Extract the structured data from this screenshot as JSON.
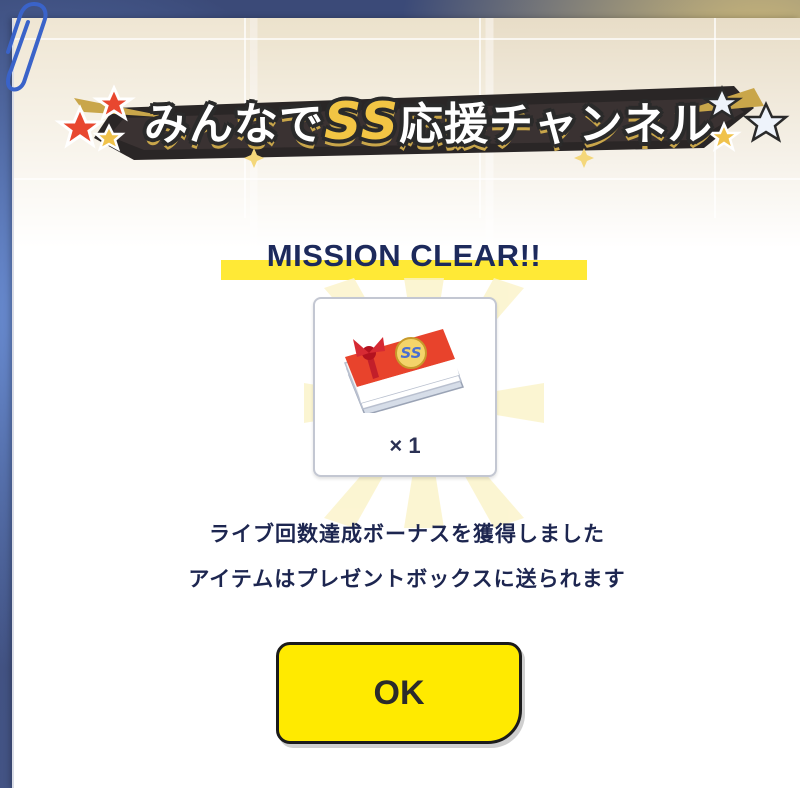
{
  "banner": {
    "title_prefix": "みんなで",
    "title_ss": "SS",
    "title_suffix": "応援チャンネル"
  },
  "mission": {
    "status": "MISSION CLEAR!!"
  },
  "reward": {
    "icon": "ss-ticket-icon",
    "quantity": "× 1"
  },
  "message": {
    "line1": "ライブ回数達成ボーナスを獲得しました",
    "line2": "アイテムはプレゼントボックスに送られます"
  },
  "ok_button": {
    "label": "OK"
  },
  "colors": {
    "accent_yellow": "#ffea00",
    "highlight_yellow": "#ffe936",
    "text_navy": "#1d2650",
    "gold": "#f2c544"
  }
}
